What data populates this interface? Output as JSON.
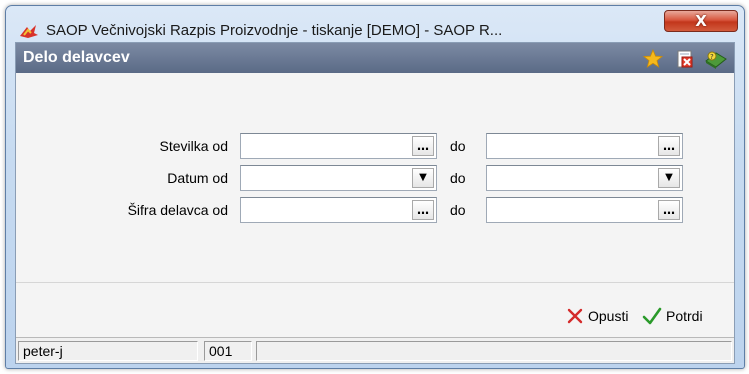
{
  "window": {
    "title": "SAOP   Večnivojski Razpis Proizvodnje - tiskanje [DEMO] - SAOP R...",
    "close_label": "X"
  },
  "panel": {
    "title": "Delo delavcev",
    "header_icons": [
      "star-icon",
      "delete-report-icon",
      "help-book-icon"
    ]
  },
  "form": {
    "rows": [
      {
        "label": "Stevilka od",
        "to_label": "do",
        "from_value": "",
        "to_value": "",
        "button": "…"
      },
      {
        "label": "Datum od",
        "to_label": "do",
        "from_value": "",
        "to_value": "",
        "button": "▼"
      },
      {
        "label": "Šifra delavca od",
        "to_label": "do",
        "from_value": "",
        "to_value": "",
        "button": "…"
      }
    ]
  },
  "actions": {
    "cancel_label": "Opusti",
    "confirm_label": "Potrdi",
    "cancel_color": "#d42a2a",
    "confirm_color": "#2a9a2a"
  },
  "statusbar": {
    "user": "peter-j",
    "code": "001",
    "info": ""
  }
}
